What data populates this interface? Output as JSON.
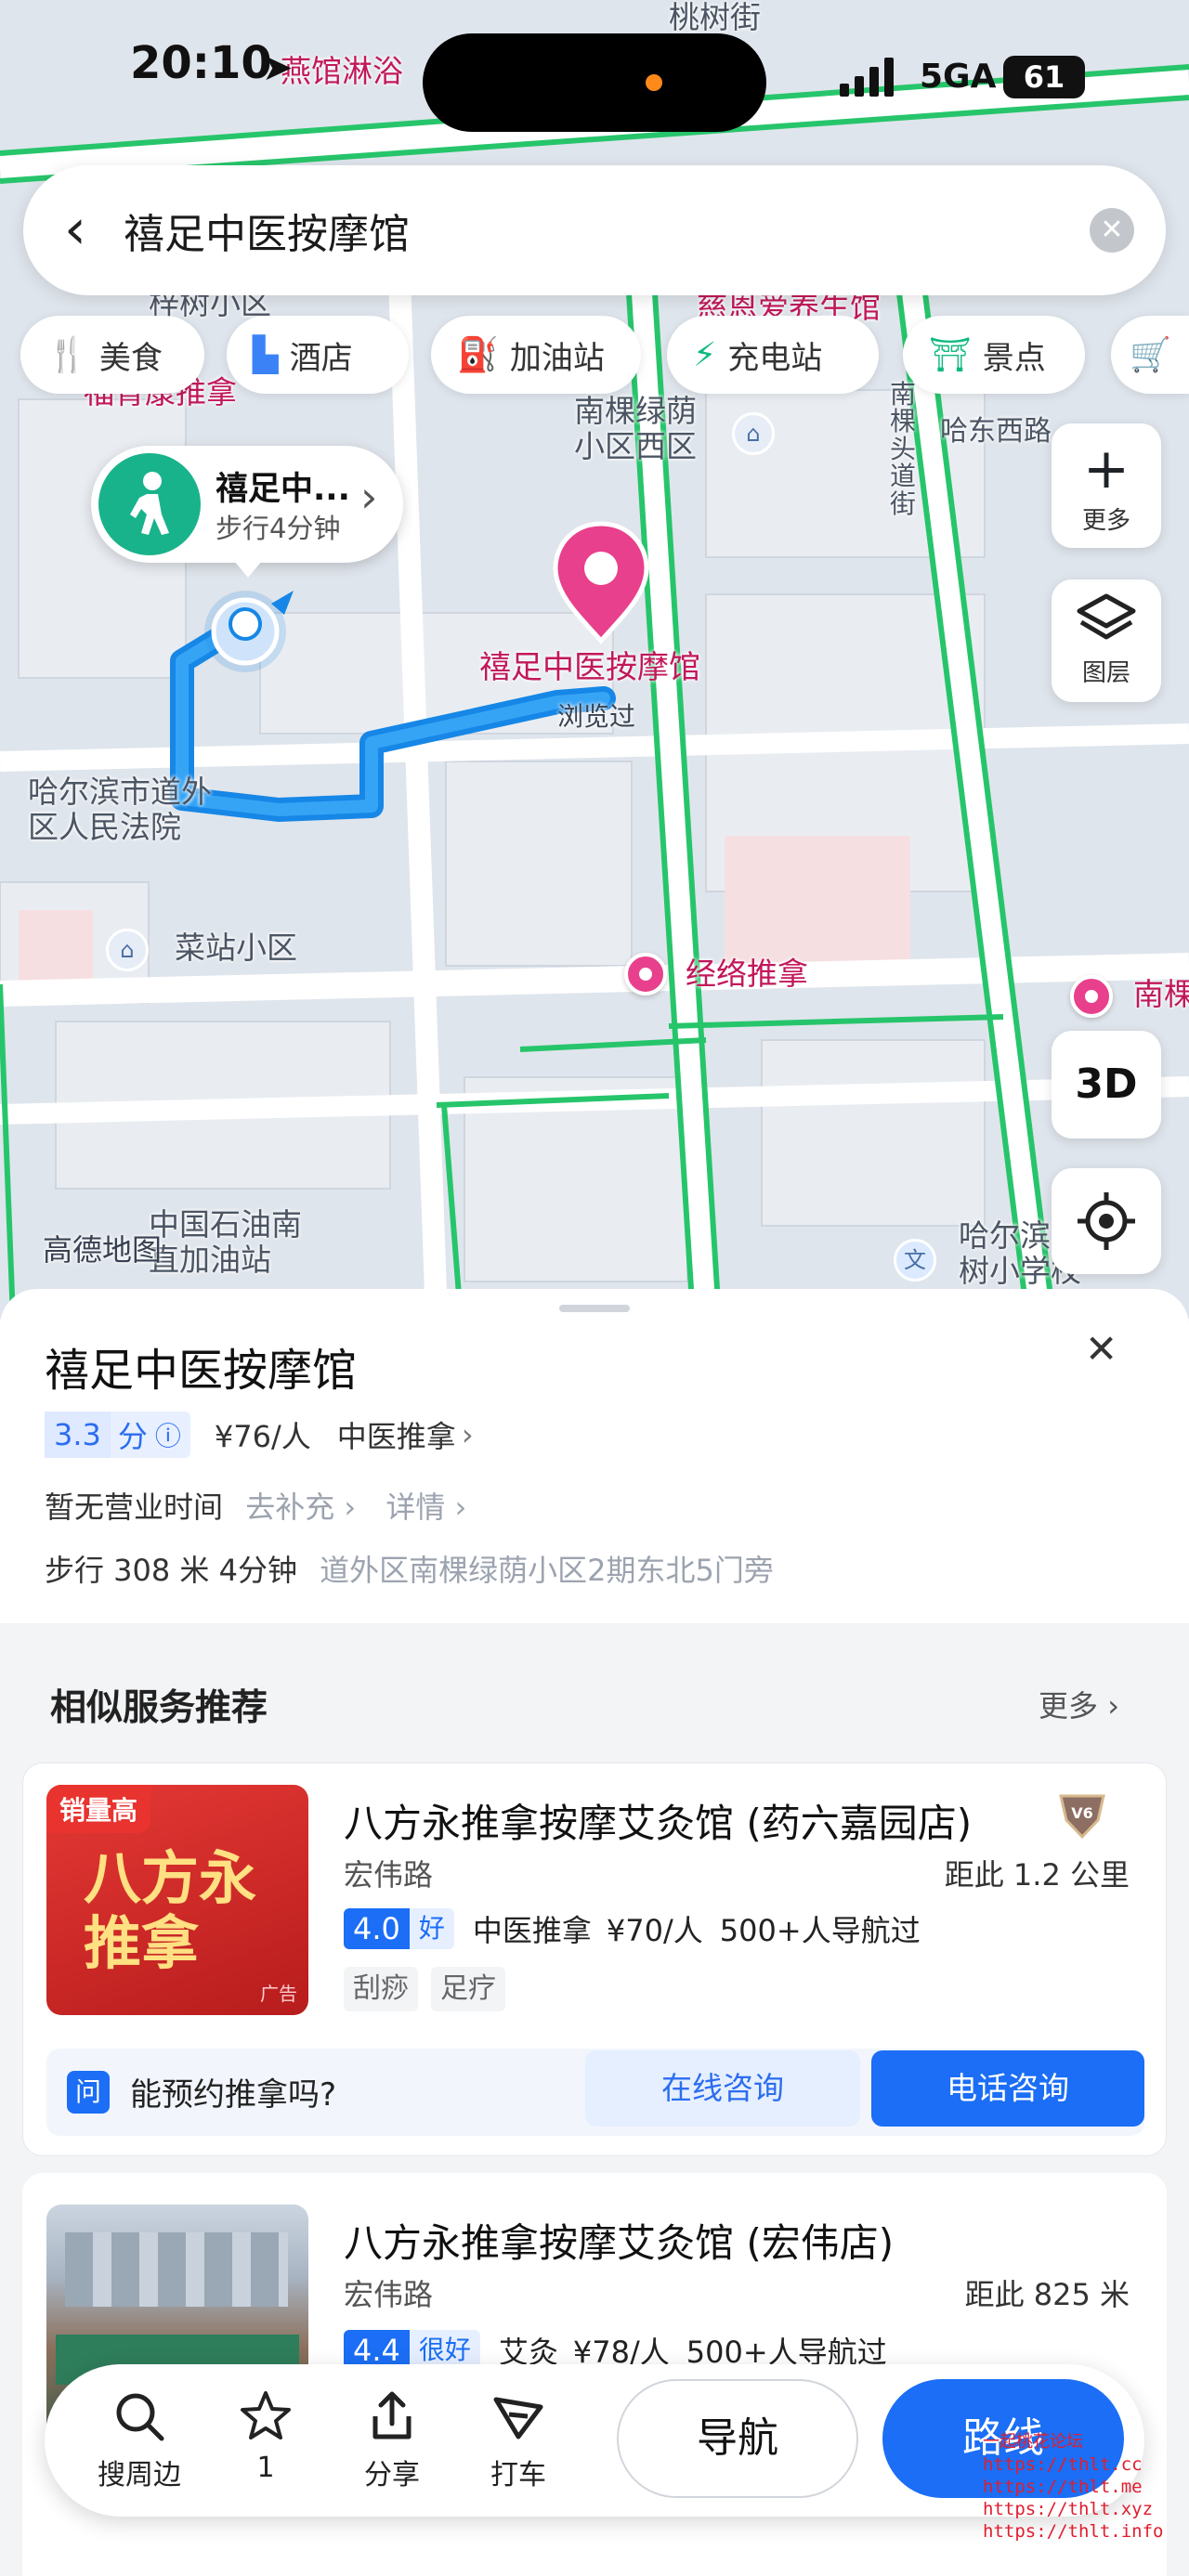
{
  "status": {
    "time": "20:10",
    "network": "5GA",
    "battery": "61"
  },
  "search": {
    "query": "禧足中医按摩馆"
  },
  "categories": [
    {
      "label": "美食",
      "icon": "fork-knife-icon",
      "color": "#f59e0b"
    },
    {
      "label": "酒店",
      "icon": "building-icon",
      "color": "#3b82f6"
    },
    {
      "label": "加油站",
      "icon": "fuel-pump-icon",
      "color": "#ef4444"
    },
    {
      "label": "充电站",
      "icon": "charging-icon",
      "color": "#10b981"
    },
    {
      "label": "景点",
      "icon": "pavilion-icon",
      "color": "#10b981"
    }
  ],
  "map": {
    "labels": {
      "street_top": "桃树街",
      "bathhouse": "燕馆淋浴",
      "zitong": "梓树小区",
      "health": "慈恩爱养生馆",
      "fuyun": "福青康推拿",
      "nanfeng_west": "南棵绿荫\n小区西区",
      "harbin_west_road": "哈东西路",
      "nanfeng_street": "南\n棵\n头\n道\n街",
      "court": "哈尔滨市道外\n区人民法院",
      "caizhan": "菜站小区",
      "jingluo": "经络推拿",
      "nanhe": "南棵",
      "petro": "中国石油南\n直加油站",
      "school": "哈尔滨\n树小学校",
      "logo": "高德地图"
    },
    "destination": {
      "name": "禧足中医按摩馆",
      "badge": "浏览过"
    }
  },
  "walk_bubble": {
    "title": "禧足中...",
    "subtitle": "步行4分钟"
  },
  "controls": {
    "more": "更多",
    "layers": "图层",
    "three_d": "3D"
  },
  "place": {
    "name": "禧足中医按摩馆",
    "score": "3.3",
    "score_unit": "分",
    "price": "¥76/人",
    "category": "中医推拿",
    "hours": "暂无营业时间",
    "hours_add": "去补充",
    "details": "详情",
    "walk": "步行 308 米 4分钟",
    "address": "道外区南棵绿荫小区2期东北5门旁"
  },
  "similar": {
    "title": "相似服务推荐",
    "more": "更多",
    "items": [
      {
        "name": "八方永推拿按摩艾灸馆 (药六嘉园店)",
        "badge": "销量高",
        "thumb_text": "八方永\n推拿",
        "ad": "广告",
        "street": "宏伟路",
        "distance": "距此 1.2 公里",
        "score": "4.0",
        "score_word": "好",
        "category": "中医推拿",
        "price": "¥70/人",
        "navigated": "500+人导航过",
        "tags": [
          "刮痧",
          "足疗"
        ],
        "question": "能预约推拿吗?",
        "btn_online": "在线咨询",
        "btn_phone": "电话咨询"
      },
      {
        "name": "八方永推拿按摩艾灸馆 (宏伟店)",
        "street": "宏伟路",
        "distance": "距此 825 米",
        "score": "4.4",
        "score_word": "很好",
        "category": "艾灸",
        "price": "¥78/人",
        "navigated": "500+人导航过"
      }
    ]
  },
  "bottom_bar": {
    "search_nearby": "搜周边",
    "favorites": "1",
    "share": "分享",
    "taxi": "打车",
    "navigate": "导航",
    "route": "路线"
  },
  "watermark": {
    "brand": "一起桃花论坛",
    "urls": [
      "https://thlt.cc",
      "https://thlt.me",
      "https://thlt.xyz",
      "https://thlt.info"
    ]
  }
}
